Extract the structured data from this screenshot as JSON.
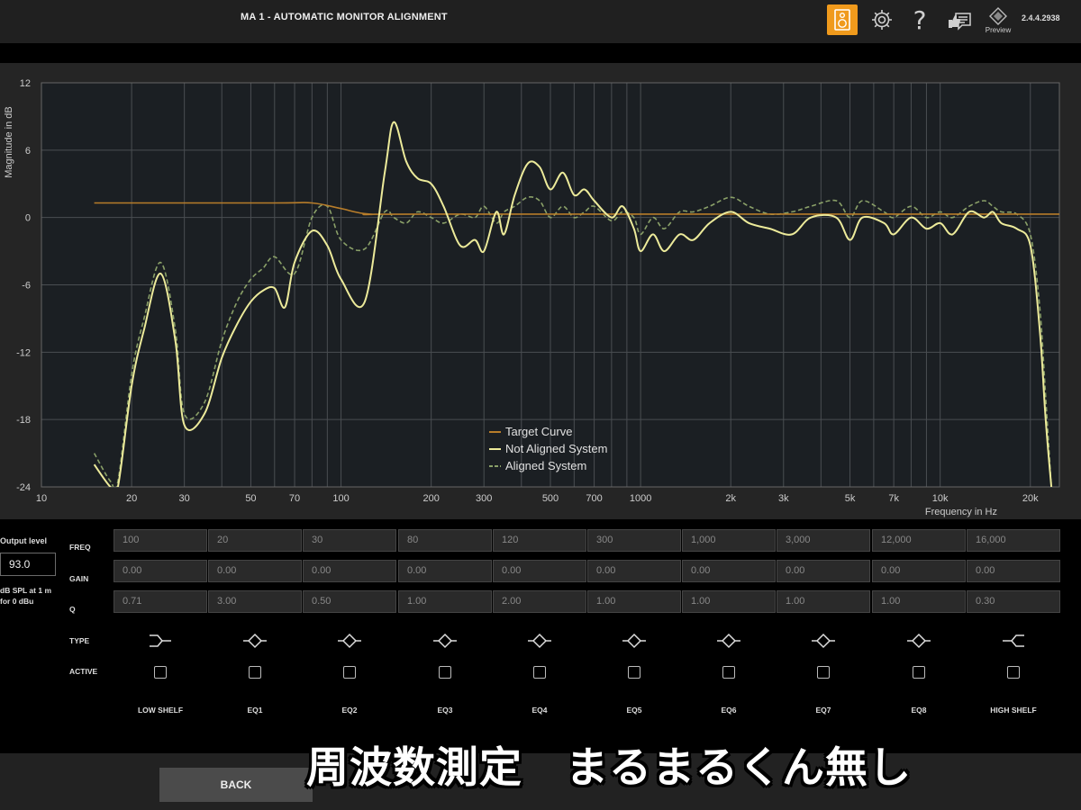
{
  "app": {
    "title": "MA 1 - AUTOMATIC MONITOR ALIGNMENT",
    "version": "2.4.4.2938",
    "accent_color": "#f09a1c",
    "toolbar": [
      {
        "name": "speaker-icon",
        "active": true
      },
      {
        "name": "gear-icon"
      },
      {
        "name": "help-icon",
        "glyph": "?"
      },
      {
        "name": "feedback-icon"
      },
      {
        "name": "preview-icon",
        "label": "Preview"
      }
    ]
  },
  "chart_data": {
    "type": "line",
    "ylabel": "Magnitude in dB",
    "xlabel": "Frequency in Hz",
    "x_scale": "log",
    "xlim": [
      10,
      25000
    ],
    "ylim": [
      -24,
      12
    ],
    "grid": true,
    "yticks": [
      {
        "v": 12,
        "label": "12"
      },
      {
        "v": 6,
        "label": "6"
      },
      {
        "v": 0,
        "label": "0"
      },
      {
        "v": -6,
        "label": "-6"
      },
      {
        "v": -12,
        "label": "-12"
      },
      {
        "v": -18,
        "label": "-18"
      },
      {
        "v": -24,
        "label": "-24"
      }
    ],
    "xticks": [
      {
        "v": 10,
        "label": "10"
      },
      {
        "v": 20,
        "label": "20"
      },
      {
        "v": 30,
        "label": "30"
      },
      {
        "v": 50,
        "label": "50"
      },
      {
        "v": 70,
        "label": "70"
      },
      {
        "v": 100,
        "label": "100"
      },
      {
        "v": 200,
        "label": "200"
      },
      {
        "v": 300,
        "label": "300"
      },
      {
        "v": 500,
        "label": "500"
      },
      {
        "v": 700,
        "label": "700"
      },
      {
        "v": 1000,
        "label": "1000"
      },
      {
        "v": 2000,
        "label": "2k"
      },
      {
        "v": 3000,
        "label": "3k"
      },
      {
        "v": 5000,
        "label": "5k"
      },
      {
        "v": 7000,
        "label": "7k"
      },
      {
        "v": 10000,
        "label": "10k"
      },
      {
        "v": 20000,
        "label": "20k"
      }
    ],
    "grid_x": [
      20,
      30,
      40,
      50,
      60,
      70,
      80,
      90,
      100,
      200,
      300,
      400,
      500,
      600,
      700,
      800,
      900,
      1000,
      2000,
      3000,
      4000,
      5000,
      6000,
      7000,
      8000,
      9000,
      10000,
      20000
    ],
    "legend": {
      "position": "bottom-center"
    },
    "series": [
      {
        "name": "Target Curve",
        "color": "#b87d2a",
        "dash": "none",
        "points": [
          [
            15,
            1.3
          ],
          [
            60,
            1.3
          ],
          [
            80,
            1.3
          ],
          [
            100,
            0.8
          ],
          [
            125,
            0.3
          ],
          [
            200,
            0.3
          ],
          [
            25000,
            0.3
          ]
        ]
      },
      {
        "name": "Not Aligned System",
        "color": "#ecea9a",
        "dash": "none",
        "points": [
          [
            15,
            -22
          ],
          [
            17,
            -24
          ],
          [
            18,
            -24
          ],
          [
            20,
            -15
          ],
          [
            22,
            -10
          ],
          [
            25,
            -5
          ],
          [
            28,
            -11
          ],
          [
            30,
            -18.5
          ],
          [
            35,
            -17.5
          ],
          [
            40,
            -12.5
          ],
          [
            45,
            -9.5
          ],
          [
            50,
            -7.5
          ],
          [
            55,
            -6.5
          ],
          [
            60,
            -6.3
          ],
          [
            65,
            -8
          ],
          [
            70,
            -4
          ],
          [
            80,
            -1.2
          ],
          [
            90,
            -2.5
          ],
          [
            100,
            -5.5
          ],
          [
            120,
            -7.5
          ],
          [
            140,
            4
          ],
          [
            150,
            8.5
          ],
          [
            165,
            5
          ],
          [
            180,
            3.5
          ],
          [
            200,
            3
          ],
          [
            220,
            1
          ],
          [
            250,
            -2.5
          ],
          [
            280,
            -2
          ],
          [
            300,
            -3
          ],
          [
            330,
            0.5
          ],
          [
            350,
            -1.5
          ],
          [
            380,
            2
          ],
          [
            420,
            4.8
          ],
          [
            460,
            4.5
          ],
          [
            500,
            2.5
          ],
          [
            550,
            4
          ],
          [
            600,
            2
          ],
          [
            650,
            2.5
          ],
          [
            700,
            1.5
          ],
          [
            800,
            0
          ],
          [
            870,
            1
          ],
          [
            950,
            -1
          ],
          [
            1000,
            -3
          ],
          [
            1100,
            -1.5
          ],
          [
            1200,
            -3
          ],
          [
            1350,
            -1.5
          ],
          [
            1500,
            -2
          ],
          [
            1700,
            -0.5
          ],
          [
            2000,
            0.5
          ],
          [
            2300,
            -0.5
          ],
          [
            2700,
            -1
          ],
          [
            3200,
            -1.5
          ],
          [
            3700,
            0
          ],
          [
            4500,
            0
          ],
          [
            5000,
            -2
          ],
          [
            5500,
            0
          ],
          [
            6500,
            -0.5
          ],
          [
            7000,
            -1.5
          ],
          [
            8000,
            0
          ],
          [
            9000,
            -1
          ],
          [
            10000,
            -0.5
          ],
          [
            11000,
            -1.5
          ],
          [
            12500,
            0.5
          ],
          [
            14000,
            0
          ],
          [
            15000,
            0.5
          ],
          [
            16000,
            -0.5
          ],
          [
            18000,
            -1
          ],
          [
            20000,
            -2.5
          ],
          [
            21500,
            -10
          ],
          [
            22500,
            -18
          ],
          [
            23500,
            -24
          ]
        ]
      },
      {
        "name": "Aligned System",
        "color": "#8aa068",
        "dash": "5,3",
        "points": [
          [
            15,
            -21
          ],
          [
            17,
            -23.5
          ],
          [
            18,
            -23.5
          ],
          [
            20,
            -14
          ],
          [
            22,
            -9
          ],
          [
            25,
            -4
          ],
          [
            28,
            -10
          ],
          [
            30,
            -17.5
          ],
          [
            35,
            -16.5
          ],
          [
            40,
            -11
          ],
          [
            45,
            -7.5
          ],
          [
            50,
            -5.5
          ],
          [
            55,
            -4.5
          ],
          [
            60,
            -3.5
          ],
          [
            70,
            -5
          ],
          [
            80,
            0
          ],
          [
            90,
            1
          ],
          [
            100,
            -2
          ],
          [
            120,
            -2.8
          ],
          [
            140,
            0.5
          ],
          [
            150,
            0
          ],
          [
            165,
            -0.5
          ],
          [
            180,
            0.5
          ],
          [
            200,
            0
          ],
          [
            220,
            -0.5
          ],
          [
            250,
            0.3
          ],
          [
            280,
            0
          ],
          [
            300,
            1
          ],
          [
            330,
            -0.5
          ],
          [
            350,
            0.5
          ],
          [
            380,
            1
          ],
          [
            420,
            1.8
          ],
          [
            460,
            1.5
          ],
          [
            500,
            0
          ],
          [
            550,
            1
          ],
          [
            600,
            0
          ],
          [
            650,
            0.5
          ],
          [
            700,
            1
          ],
          [
            800,
            -0.3
          ],
          [
            870,
            0.5
          ],
          [
            950,
            0
          ],
          [
            1000,
            -1.5
          ],
          [
            1100,
            0
          ],
          [
            1200,
            -1
          ],
          [
            1350,
            0.5
          ],
          [
            1500,
            0.5
          ],
          [
            1700,
            1
          ],
          [
            2000,
            1.8
          ],
          [
            2300,
            1
          ],
          [
            2700,
            0.3
          ],
          [
            3200,
            0.5
          ],
          [
            3700,
            1
          ],
          [
            4500,
            1.5
          ],
          [
            5000,
            0
          ],
          [
            5500,
            1.5
          ],
          [
            6500,
            0.5
          ],
          [
            7000,
            0
          ],
          [
            8000,
            1
          ],
          [
            9000,
            0
          ],
          [
            10000,
            0.5
          ],
          [
            11000,
            0
          ],
          [
            12500,
            1
          ],
          [
            14000,
            1.5
          ],
          [
            15000,
            1
          ],
          [
            16000,
            0.5
          ],
          [
            18000,
            0.3
          ],
          [
            20000,
            -1.5
          ],
          [
            21500,
            -8
          ],
          [
            22500,
            -16
          ],
          [
            23500,
            -24
          ]
        ]
      }
    ]
  },
  "output": {
    "label": "Output level",
    "value": "93.0",
    "unit": "dB SPL at 1 m for 0 dBu"
  },
  "row_labels": {
    "freq": "FREQ",
    "gain": "GAIN",
    "q": "Q",
    "type": "TYPE",
    "active": "ACTIVE"
  },
  "bands": [
    {
      "name": "LOW SHELF",
      "freq": "100",
      "gain": "0.00",
      "q": "0.71",
      "type": "low-shelf",
      "active": false
    },
    {
      "name": "EQ1",
      "freq": "20",
      "gain": "0.00",
      "q": "3.00",
      "type": "peak",
      "active": false
    },
    {
      "name": "EQ2",
      "freq": "30",
      "gain": "0.00",
      "q": "0.50",
      "type": "peak",
      "active": false
    },
    {
      "name": "EQ3",
      "freq": "80",
      "gain": "0.00",
      "q": "1.00",
      "type": "peak",
      "active": false
    },
    {
      "name": "EQ4",
      "freq": "120",
      "gain": "0.00",
      "q": "2.00",
      "type": "peak",
      "active": false
    },
    {
      "name": "EQ5",
      "freq": "300",
      "gain": "0.00",
      "q": "1.00",
      "type": "peak",
      "active": false
    },
    {
      "name": "EQ6",
      "freq": "1,000",
      "gain": "0.00",
      "q": "1.00",
      "type": "peak",
      "active": false
    },
    {
      "name": "EQ7",
      "freq": "3,000",
      "gain": "0.00",
      "q": "1.00",
      "type": "peak",
      "active": false
    },
    {
      "name": "EQ8",
      "freq": "12,000",
      "gain": "0.00",
      "q": "1.00",
      "type": "peak",
      "active": false
    },
    {
      "name": "HIGH SHELF",
      "freq": "16,000",
      "gain": "0.00",
      "q": "0.30",
      "type": "high-shelf",
      "active": false
    }
  ],
  "footer": {
    "back_label": "BACK"
  },
  "overlay_caption": "周波数測定　まるまるくん無し"
}
